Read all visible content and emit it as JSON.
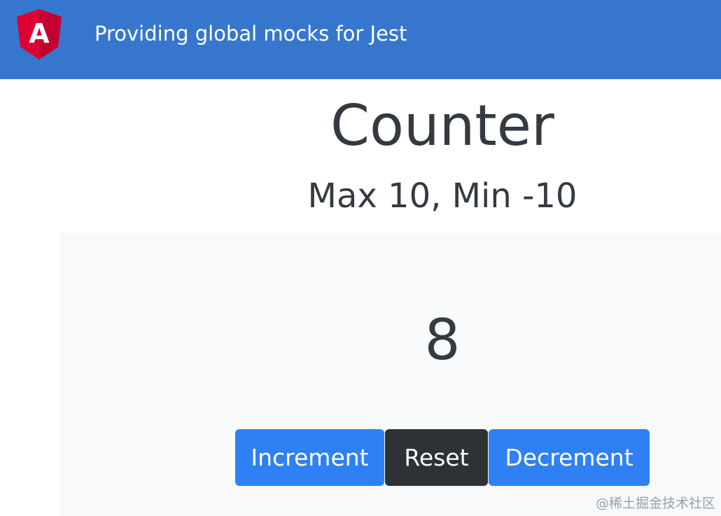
{
  "header": {
    "logo_icon": "angular-shield-icon",
    "logo_letter": "A",
    "title": "Providing global mocks for Jest",
    "background_color": "#3677cd"
  },
  "counter": {
    "title": "Counter",
    "subtitle": "Max 10, Min -10",
    "value": "8"
  },
  "buttons": {
    "increment_label": "Increment",
    "reset_label": "Reset",
    "decrement_label": "Decrement",
    "primary_color": "#2f80f5",
    "dark_color": "#2e3235"
  },
  "watermark": {
    "text": "@稀土掘金技术社区"
  }
}
